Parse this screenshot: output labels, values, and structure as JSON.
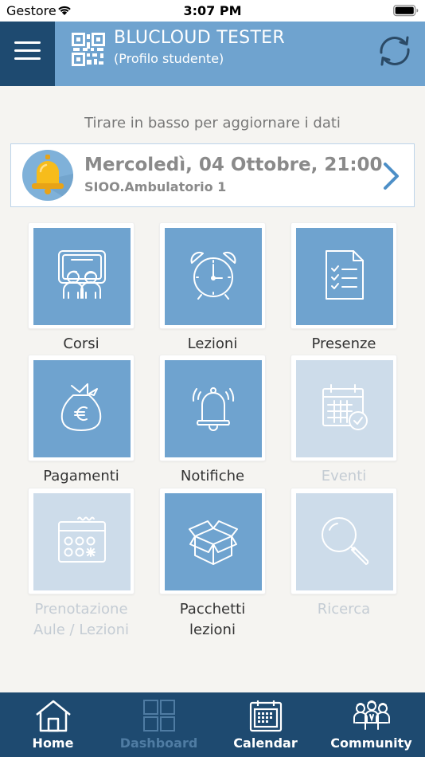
{
  "status_bar": {
    "carrier": "Gestore",
    "time": "3:07 PM"
  },
  "header": {
    "title": "BLUCLOUD TESTER",
    "subtitle": "(Profilo studente)",
    "icons": [
      "menu-icon",
      "qr-code-icon",
      "refresh-icon"
    ]
  },
  "hint": "Tirare in basso per aggiornare i dati",
  "notification": {
    "date": "Mercoledì, 04 Ottobre, 21:00",
    "place": "SIOO.Ambulatorio 1",
    "icon": "bell-icon"
  },
  "tiles": [
    {
      "label": "Corsi",
      "icon": "classroom-icon",
      "enabled": true
    },
    {
      "label": "Lezioni",
      "icon": "alarm-clock-icon",
      "enabled": true
    },
    {
      "label": "Presenze",
      "icon": "checklist-icon",
      "enabled": true
    },
    {
      "label": "Pagamenti",
      "icon": "money-bag-icon",
      "enabled": true
    },
    {
      "label": "Notifiche",
      "icon": "ringing-bell-icon",
      "enabled": true
    },
    {
      "label": "Eventi",
      "icon": "calendar-check-icon",
      "enabled": false
    },
    {
      "label_line1": "Prenotazione",
      "label_line2": "Aule / Lezioni",
      "icon": "booking-calendar-icon",
      "enabled": false
    },
    {
      "label_line1": "Pacchetti",
      "label_line2": "lezioni",
      "icon": "open-box-icon",
      "enabled": true
    },
    {
      "label": "Ricerca",
      "icon": "magnifier-icon",
      "enabled": false
    }
  ],
  "tabbar": {
    "active": "Dashboard",
    "items": [
      {
        "label": "Home",
        "icon": "home-icon"
      },
      {
        "label": "Dashboard",
        "icon": "grid-icon"
      },
      {
        "label": "Calendar",
        "icon": "calendar-icon"
      },
      {
        "label": "Community",
        "icon": "people-group-icon"
      }
    ]
  },
  "colors": {
    "header": "#6fa3cf",
    "menu_button": "#1e4a70",
    "tabbar": "#1e4a70",
    "tile": "#6fa3cf",
    "tile_disabled": "#cddcea",
    "background": "#f5f4f1"
  }
}
